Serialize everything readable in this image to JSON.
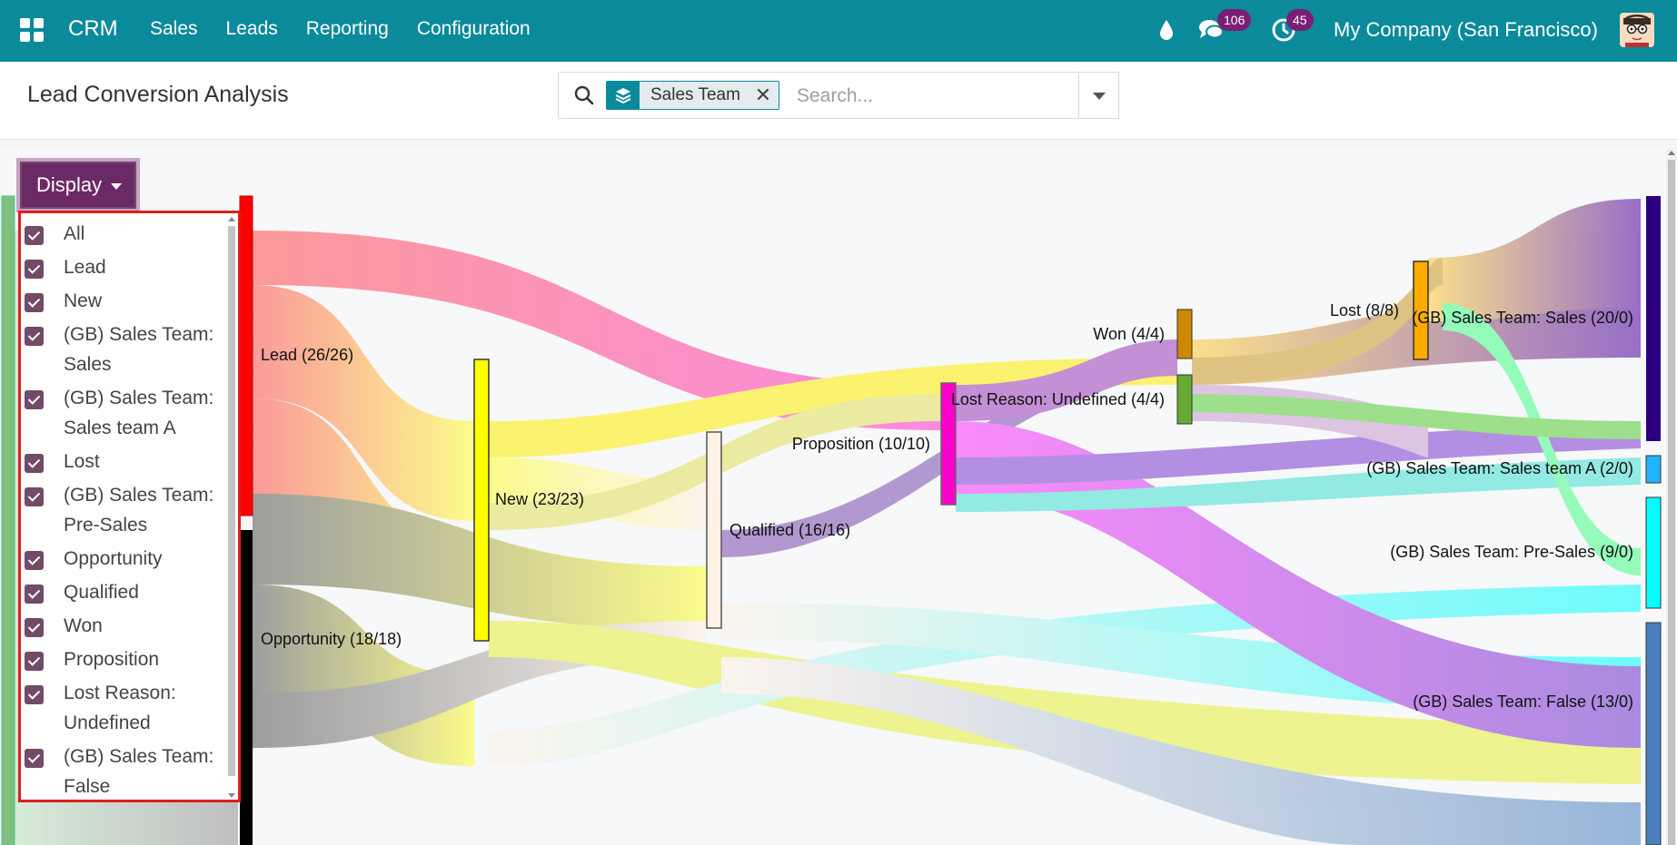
{
  "navbar": {
    "brand": "CRM",
    "menu": [
      "Sales",
      "Leads",
      "Reporting",
      "Configuration"
    ],
    "messages_count": "106",
    "activities_count": "45",
    "company": "My Company (San Francisco)"
  },
  "control_panel": {
    "title": "Lead Conversion Analysis",
    "facet_label": "Sales Team",
    "facet_remove": "✕",
    "search_placeholder": "Search..."
  },
  "display": {
    "button_label": "Display",
    "options": [
      {
        "label": "All",
        "checked": true
      },
      {
        "label": "Lead",
        "checked": true
      },
      {
        "label": "New",
        "checked": true
      },
      {
        "label": "(GB) Sales Team: Sales",
        "checked": true
      },
      {
        "label": "(GB) Sales Team: Sales team A",
        "checked": true
      },
      {
        "label": "Lost",
        "checked": true
      },
      {
        "label": "(GB) Sales Team: Pre-Sales",
        "checked": true
      },
      {
        "label": "Opportunity",
        "checked": true
      },
      {
        "label": "Qualified",
        "checked": true
      },
      {
        "label": "Won",
        "checked": true
      },
      {
        "label": "Proposition",
        "checked": true
      },
      {
        "label": "Lost Reason: Undefined",
        "checked": true
      },
      {
        "label": "(GB) Sales Team: False",
        "checked": true
      }
    ]
  },
  "sankey": {
    "node_labels": {
      "lead": "Lead (26/26)",
      "opportunity": "Opportunity (18/18)",
      "new": "New (23/23)",
      "qualified": "Qualified (16/16)",
      "proposition": "Proposition (10/10)",
      "won": "Won (4/4)",
      "lost_reason": "Lost Reason: Undefined (4/4)",
      "lost": "Lost (8/8)",
      "gb_sales": "(GB) Sales Team: Sales (20/0)",
      "gb_sales_a": "(GB) Sales Team: Sales team A (2/0)",
      "gb_presales": "(GB) Sales Team: Pre-Sales (9/0)",
      "gb_false": "(GB) Sales Team: False (13/0)"
    },
    "colors": {
      "lead": "#ff0000",
      "opportunity": "#000000",
      "new": "#ffff00",
      "qualified": "#fff2e6",
      "proposition": "#ff00ff",
      "won": "#cc8800",
      "lost_reason": "#66bb33",
      "lost": "#ffaa00",
      "gb_sales": "#2a0080",
      "gb_sales_a": "#1fb5ff",
      "gb_presales": "#00ffff",
      "gb_false": "#4a7fbf"
    }
  }
}
